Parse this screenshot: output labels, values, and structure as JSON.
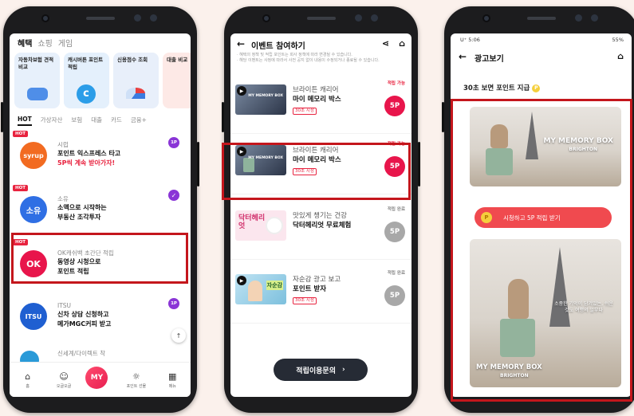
{
  "phone1": {
    "tabs": [
      "혜택",
      "쇼핑",
      "게임"
    ],
    "cards": [
      {
        "label": "자동차보험 견적비교"
      },
      {
        "label": "캐시버튼 포인트 적립"
      },
      {
        "label": "신용점수 조회"
      },
      {
        "label": "대출 비교"
      }
    ],
    "categories": [
      "HOT",
      "가상자산",
      "보험",
      "대출",
      "카드",
      "금융+"
    ],
    "hot_label": "HOT",
    "items": [
      {
        "logo": "syrup",
        "name": "시럽",
        "line1": "포인트 익스프레스 타고",
        "line2": "5P씩 계속 받아가자!",
        "badge": "1P"
      },
      {
        "logo": "소유",
        "name": "소유",
        "line1": "소액으로 시작하는",
        "line2": "부동산 조각투자",
        "badge": "✓"
      },
      {
        "logo": "OK",
        "name": "OK캐쉬백 초간단 적립",
        "line1": "동영상 시청으로",
        "line2": "포인트 적립",
        "badge": ""
      },
      {
        "logo": "ITSU",
        "name": "ITSU",
        "line1": "신차 상담 신청하고",
        "line2": "메가MGC커피 받고",
        "badge": "1P"
      },
      {
        "logo": "",
        "name": "신세계/다이렉트 착",
        "line1": "",
        "line2": "",
        "badge": ""
      }
    ],
    "nav": [
      "홈",
      "오글오글",
      "MY",
      "포인트 선물",
      "메뉴"
    ],
    "nav_new": "NEW"
  },
  "phone2": {
    "title": "이벤트 참여하기",
    "notice": "· 혜택의 정책 및 적립 포인트는 회사 정책에 따라 변경될 수 있습니다.\n· 해당 이벤트는 사정에 따라서 사전 공지 없이 내용이 수정되거나 종료될 수 있습니다.",
    "events": [
      {
        "line1": "브라이튼 캐리어",
        "line2": "마이 메모리 박스",
        "tag": "30초 시청",
        "status": "적립 가능",
        "points": "5P",
        "active": true,
        "thumb_text": "MY MEMORY BOX"
      },
      {
        "line1": "브라이튼 캐리어",
        "line2": "마이 메모리 박스",
        "tag": "30초 시청",
        "status": "적립 가능",
        "points": "5P",
        "active": true,
        "thumb_text": "MY MEMORY BOX"
      },
      {
        "line1": "맛있게 챙기는 건강",
        "line2": "닥터헤리엇 무료체험",
        "tag": "",
        "status": "적립 완료",
        "points": "5P",
        "active": false,
        "thumb_text": "닥터헤리엇"
      },
      {
        "line1": "자순감 광고 보고",
        "line2": "포인트 받자",
        "tag": "30초 시청",
        "status": "적립 완료",
        "points": "5P",
        "active": false,
        "thumb_text": "자순감"
      }
    ],
    "inquiry_button": "적립이용문의",
    "inquiry_arrow": "›"
  },
  "phone3": {
    "status_time": "U⁺ 5:06",
    "status_battery": "55%",
    "title": "광고보기",
    "subtitle": "30초 보면 포인트 지급",
    "coin": "P",
    "ad_title1": "MY MEMORY BOX",
    "ad_title2": "BRIGHTON",
    "ad_caption": "소중한 기억이 담겨있는, 쉬운 것도 여행의 일부다",
    "watch_button": "시청하고 5P 적립 받기",
    "watch_coin": "P"
  },
  "colors": {
    "highlight": "#c4161c",
    "accent_pink": "#e8154b",
    "purple": "#8a35d6"
  }
}
